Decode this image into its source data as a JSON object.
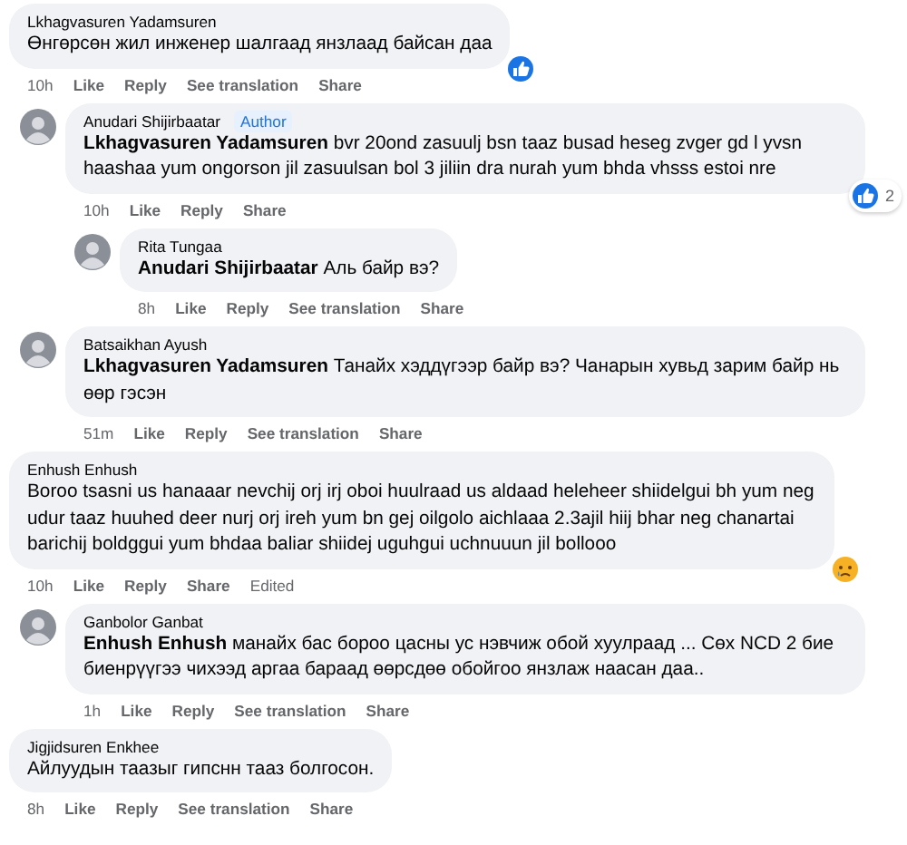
{
  "comments": [
    {
      "author": "Lkhagvasuren Yadamsuren",
      "avatar": false,
      "text": "Өнгөрсөн жил инженер шалгаад янзлаад байсан даа",
      "time": "10h",
      "actions": [
        "Like",
        "Reply",
        "See translation",
        "Share"
      ],
      "reaction": {
        "kind": "like"
      },
      "children": [
        {
          "author": "Anudari Shijirbaatar",
          "badge": "Author",
          "avatar": true,
          "text": "**Lkhagvasuren Yadamsuren** bvr 20ond zasuulj bsn taaz busad heseg zvger gd l yvsn haashaa yum ongorson jil zasuulsan bol 3 jiliin dra nurah yum bhda vhsss estoi nre",
          "time": "10h",
          "actions": [
            "Like",
            "Reply",
            "Share"
          ],
          "reaction": {
            "kind": "like",
            "count": "2"
          },
          "children": [
            {
              "author": "Rita Tungaa",
              "avatar": true,
              "text": "**Anudari Shijirbaatar** Аль байр вэ?",
              "time": "8h",
              "actions": [
                "Like",
                "Reply",
                "See translation",
                "Share"
              ]
            }
          ]
        },
        {
          "author": "Batsaikhan Ayush",
          "avatar": true,
          "text": "**Lkhagvasuren Yadamsuren** Танайх хэддүгээр байр вэ? Чанарын хувьд зарим байр нь өөр гэсэн",
          "time": "51m",
          "actions": [
            "Like",
            "Reply",
            "See translation",
            "Share"
          ]
        }
      ]
    },
    {
      "author": "Enhush Enhush",
      "avatar": false,
      "text": "Boroo tsasni us hanaaar nevchij orj irj oboi huulraad us aldaad heleheer shiidelgui bh yum neg udur taaz huuhed deer nurj orj ireh yum bn gej oilgolo aichlaaa 2.3ajil hiij bhar neg chanartai barichij boldggui yum bhdaa baliar shiidej uguhgui uchnuuun jil bollooo",
      "time": "10h",
      "actions": [
        "Like",
        "Reply",
        "Share"
      ],
      "edited": "Edited",
      "reaction": {
        "kind": "sad"
      },
      "children": [
        {
          "author": "Ganbolor Ganbat",
          "avatar": true,
          "text": "**Enhush Enhush** манайх бас бороо цасны ус нэвчиж обой хуулраад ... Сөх NCD 2 бие биенрүүгээ чихээд аргаа бараад өөрсдөө обойгоо янзлаж наасан даа..",
          "time": "1h",
          "actions": [
            "Like",
            "Reply",
            "See translation",
            "Share"
          ]
        }
      ]
    },
    {
      "author": "Jigjidsuren Enkhee",
      "avatar": false,
      "text": "Айлуудын таазыг гипснн тааз болгосон.",
      "time": "8h",
      "actions": [
        "Like",
        "Reply",
        "See translation",
        "Share"
      ]
    }
  ]
}
